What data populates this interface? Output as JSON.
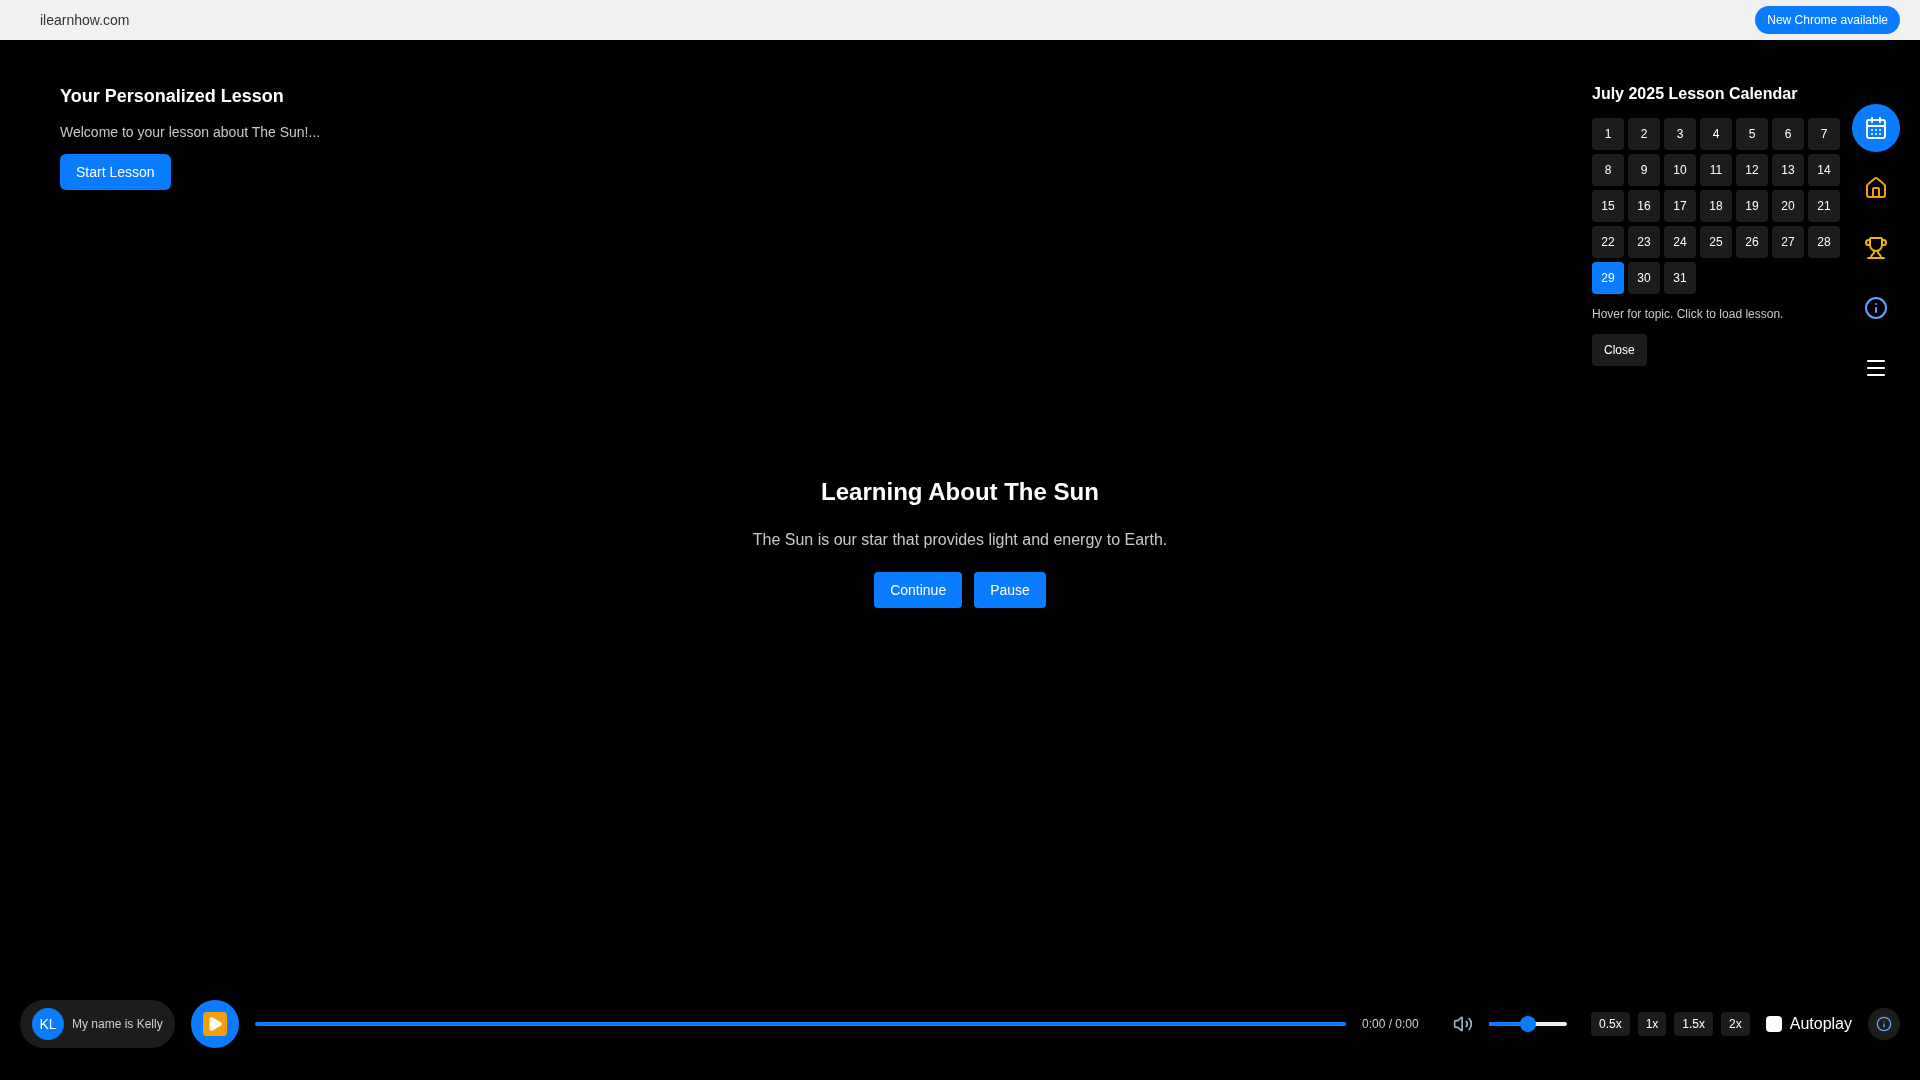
{
  "browser_bar": {
    "site": "ilearnhow.com",
    "update_button": "New Chrome available"
  },
  "lesson": {
    "title": "Your Personalized Lesson",
    "text": "Welcome to your lesson about The Sun!...",
    "button": "Start Lesson"
  },
  "calendar": {
    "title": "July 2025 Lesson Calendar",
    "days": [
      {
        "label": "1",
        "selected": false
      },
      {
        "label": "2",
        "selected": false
      },
      {
        "label": "3",
        "selected": false
      },
      {
        "label": "4",
        "selected": false
      },
      {
        "label": "5",
        "selected": false
      },
      {
        "label": "6",
        "selected": false
      },
      {
        "label": "7",
        "selected": false
      },
      {
        "label": "8",
        "selected": false
      },
      {
        "label": "9",
        "selected": false
      },
      {
        "label": "10",
        "selected": false
      },
      {
        "label": "11",
        "selected": false
      },
      {
        "label": "12",
        "selected": false
      },
      {
        "label": "13",
        "selected": false
      },
      {
        "label": "14",
        "selected": false
      },
      {
        "label": "15",
        "selected": false
      },
      {
        "label": "16",
        "selected": false
      },
      {
        "label": "17",
        "selected": false
      },
      {
        "label": "18",
        "selected": false
      },
      {
        "label": "19",
        "selected": false
      },
      {
        "label": "20",
        "selected": false
      },
      {
        "label": "21",
        "selected": false
      },
      {
        "label": "22",
        "selected": false
      },
      {
        "label": "23",
        "selected": false
      },
      {
        "label": "24",
        "selected": false
      },
      {
        "label": "25",
        "selected": false
      },
      {
        "label": "26",
        "selected": false
      },
      {
        "label": "27",
        "selected": false
      },
      {
        "label": "28",
        "selected": false
      },
      {
        "label": "29",
        "selected": true
      },
      {
        "label": "30",
        "selected": false
      },
      {
        "label": "31",
        "selected": false
      }
    ],
    "hint": "Hover for topic. Click to load lesson.",
    "close_button": "Close"
  },
  "side_nav": [
    {
      "kind": "calendar",
      "selected": true
    },
    {
      "kind": "home",
      "selected": false
    },
    {
      "kind": "trophy",
      "selected": false
    },
    {
      "kind": "info",
      "selected": false
    },
    {
      "kind": "menu",
      "selected": false
    }
  ],
  "content": {
    "title": "Learning About The Sun",
    "text": "The Sun is our star that provides light and energy to Earth.",
    "buttons": [
      "Continue",
      "Pause"
    ]
  },
  "player": {
    "narrator": {
      "initials": "KL",
      "name": "My name is Kelly"
    },
    "progress": {
      "level": 1
    },
    "time": "0:00 / 0:00",
    "volume": {
      "level": 0.5
    },
    "speeds": [
      "0.5x",
      "1x",
      "1.5x",
      "2x"
    ],
    "autoplay": {
      "label": "Autoplay",
      "checked": false
    }
  }
}
